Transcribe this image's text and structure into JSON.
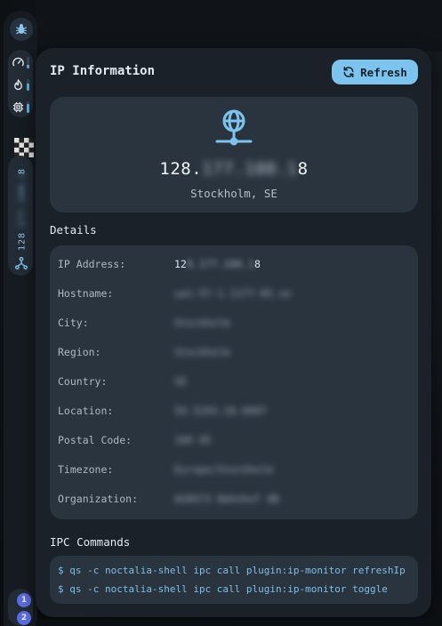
{
  "sidebar": {
    "ip_parts": [
      "128",
      "8"
    ],
    "workspaces": [
      "1",
      "2"
    ],
    "meters": {
      "cpu_gauge": 0.3,
      "temp": 0.55,
      "memory": 0.75
    }
  },
  "panel": {
    "title": "IP Information",
    "refresh_label": "Refresh"
  },
  "hero": {
    "ip_start": "128.",
    "ip_hidden": "177.180.1",
    "ip_end": "8",
    "location": "Stockholm, SE"
  },
  "details": {
    "heading": "Details",
    "rows": [
      {
        "key": "IP Address:",
        "val_start": "12",
        "val_hidden": "8.177.180.1",
        "val_end": "8"
      },
      {
        "key": "Hostname:",
        "val_hidden": "ua1-57-1.1177-85.se"
      },
      {
        "key": "City:",
        "val_hidden": "Stockholm"
      },
      {
        "key": "Region:",
        "val_hidden": "Stockholm"
      },
      {
        "key": "Country:",
        "val_hidden": "SE"
      },
      {
        "key": "Location:",
        "val_hidden": "59.3293,18.0687"
      },
      {
        "key": "Postal Code:",
        "val_hidden": "100 05"
      },
      {
        "key": "Timezone:",
        "val_hidden": "Europe/Stockholm"
      },
      {
        "key": "Organization:",
        "val_hidden": "AS8473 Bahnhof AB"
      }
    ]
  },
  "ipc": {
    "heading": "IPC Commands",
    "commands": [
      "$ qs -c noctalia-shell ipc call plugin:ip-monitor refreshIp",
      "$ qs -c noctalia-shell ipc call plugin:ip-monitor toggle"
    ]
  },
  "colors": {
    "accent": "#7cc3ee",
    "panel": "#1b2128",
    "card": "#2a343f",
    "workspace": "#5b6ce0"
  }
}
